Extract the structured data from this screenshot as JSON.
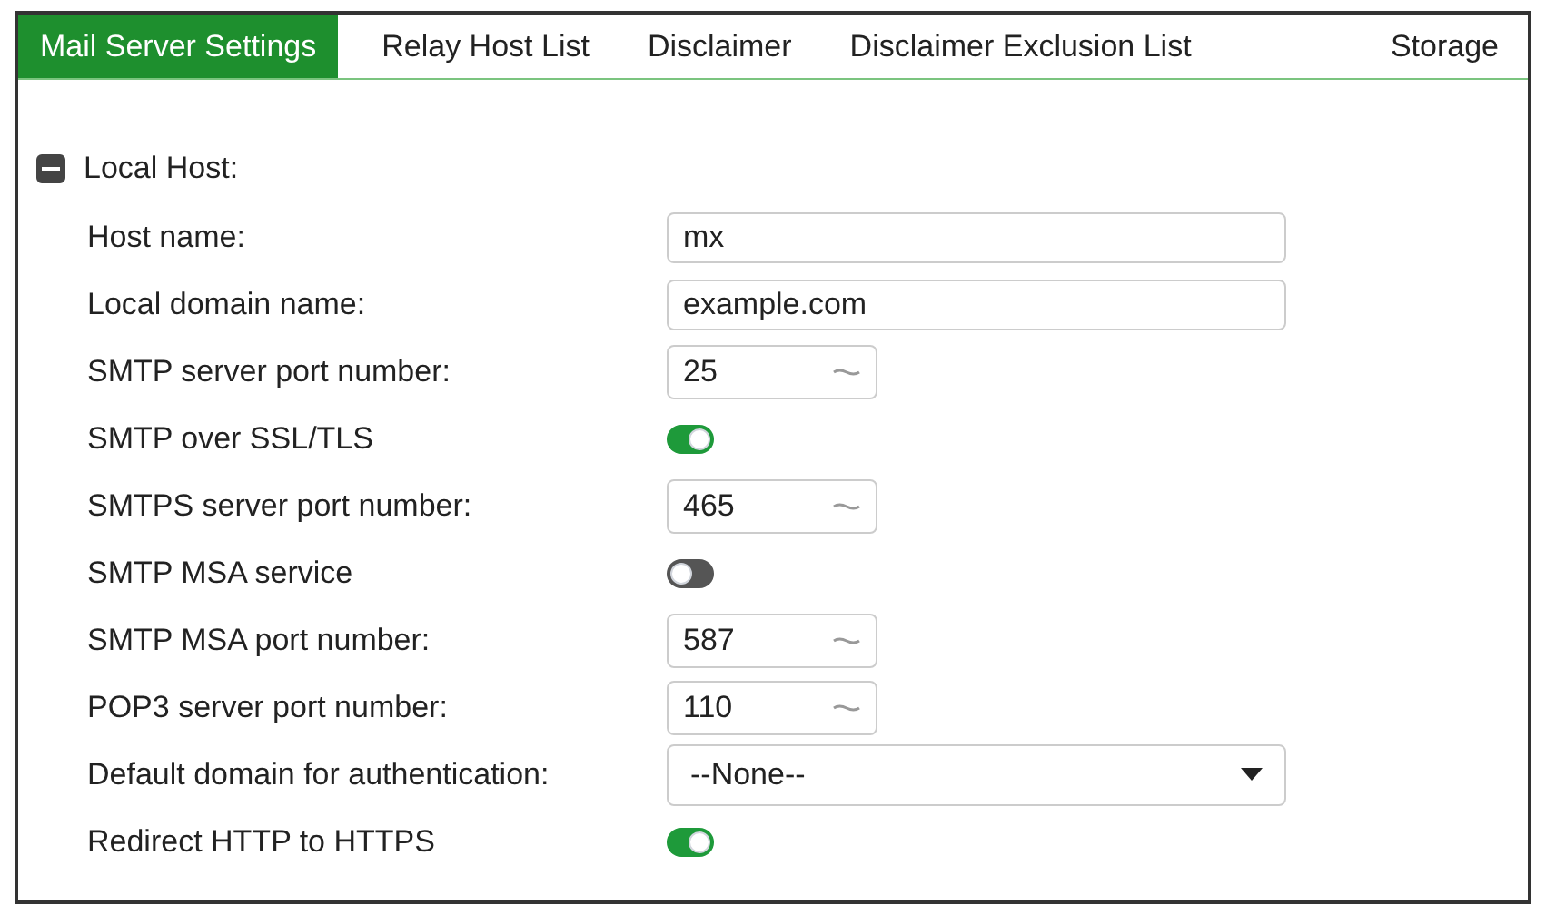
{
  "tabs": [
    {
      "label": "Mail Server Settings",
      "selected": true
    },
    {
      "label": "Relay Host List",
      "selected": false
    },
    {
      "label": "Disclaimer",
      "selected": false
    },
    {
      "label": "Disclaimer Exclusion List",
      "selected": false
    },
    {
      "label": "Storage",
      "selected": false
    }
  ],
  "section": {
    "title": "Local Host:",
    "expanded": true
  },
  "rows": [
    {
      "kind": "text",
      "label": "Host name:",
      "value": "mx"
    },
    {
      "kind": "text",
      "label": "Local domain name:",
      "value": "example.com"
    },
    {
      "kind": "number",
      "label": "SMTP server port number:",
      "value": "25"
    },
    {
      "kind": "toggle",
      "label": "SMTP over SSL/TLS",
      "on": true
    },
    {
      "kind": "number",
      "label": "SMTPS server port number:",
      "value": "465"
    },
    {
      "kind": "toggle",
      "label": "SMTP MSA service",
      "on": false
    },
    {
      "kind": "number",
      "label": "SMTP MSA port number:",
      "value": "587"
    },
    {
      "kind": "number",
      "label": "POP3 server port number:",
      "value": "110"
    },
    {
      "kind": "select",
      "label": "Default domain for authentication:",
      "value": "--None--"
    },
    {
      "kind": "toggle",
      "label": "Redirect HTTP to HTTPS",
      "on": true
    }
  ]
}
